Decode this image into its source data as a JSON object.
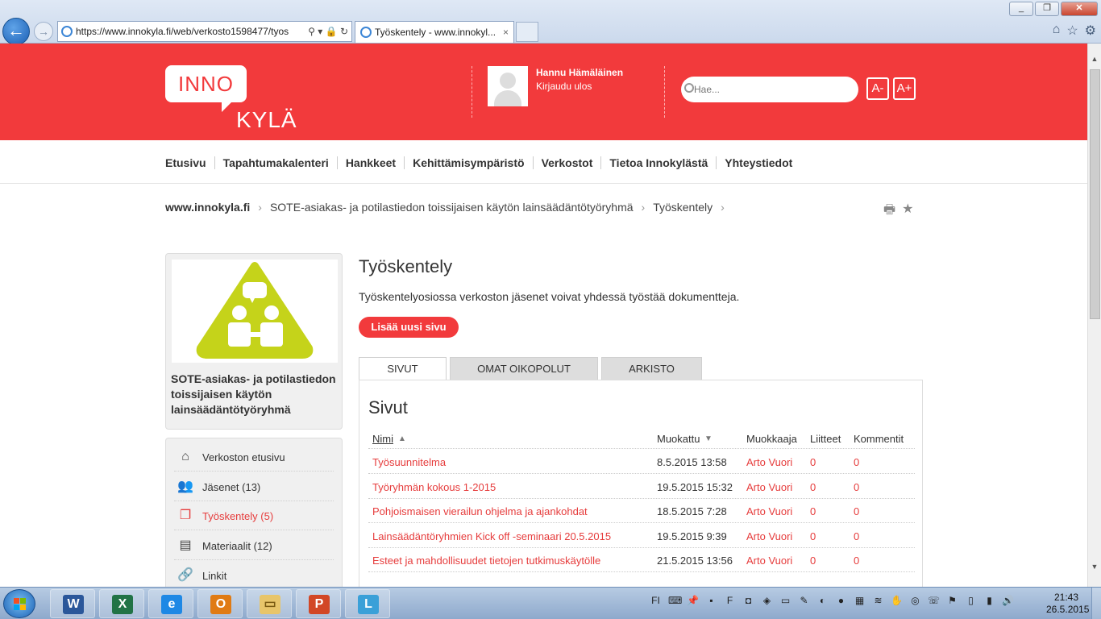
{
  "browser": {
    "url": "https://www.innokyla.fi/web/verkosto1598477/tyos",
    "tab_title": "Työskentely - www.innokyl...",
    "tab_close": "×"
  },
  "header": {
    "logo_top": "INNO",
    "logo_bottom": "KYLÄ",
    "user_name": "Hannu Hämäläinen",
    "logout": "Kirjaudu ulos",
    "search_placeholder": "Hae...",
    "font_smaller": "A-",
    "font_larger": "A+"
  },
  "nav": [
    "Etusivu",
    "Tapahtumakalenteri",
    "Hankkeet",
    "Kehittämisympäristö",
    "Verkostot",
    "Tietoa Innokylästä",
    "Yhteystiedot"
  ],
  "breadcrumb": {
    "items": [
      "www.innokyla.fi",
      "SOTE-asiakas- ja potilastiedon toissijaisen käytön lainsäädäntötyöryhmä",
      "Työskentely"
    ],
    "sep": "›"
  },
  "sidebar": {
    "group_title": "SOTE-asiakas- ja potilastiedon toissijaisen käytön lainsäädäntötyöryhmä",
    "items": [
      {
        "label": "Verkoston etusivu",
        "icon": "home-icon",
        "active": false
      },
      {
        "label": "Jäsenet (13)",
        "icon": "members-icon",
        "active": false
      },
      {
        "label": "Työskentely (5)",
        "icon": "documents-icon",
        "active": true
      },
      {
        "label": "Materiaalit (12)",
        "icon": "materials-icon",
        "active": false
      },
      {
        "label": "Linkit",
        "icon": "link-icon",
        "active": false
      }
    ]
  },
  "main": {
    "title": "Työskentely",
    "intro": "Työskentelyosiossa verkoston jäsenet voivat yhdessä työstää dokumentteja.",
    "add_button": "Lisää uusi sivu",
    "tabs": [
      "SIVUT",
      "OMAT OIKOPOLUT",
      "ARKISTO"
    ],
    "panel_title": "Sivut",
    "columns": {
      "name": "Nimi",
      "modified": "Muokattu",
      "editor": "Muokkaaja",
      "attachments": "Liitteet",
      "comments": "Kommentit"
    },
    "sort_asc": "▲",
    "sort_desc": "▼",
    "rows": [
      {
        "name": "Työsuunnitelma",
        "modified": "8.5.2015 13:58",
        "editor": "Arto Vuori",
        "attachments": "0",
        "comments": "0"
      },
      {
        "name": "Työryhmän kokous 1-2015",
        "modified": "19.5.2015 15:32",
        "editor": "Arto Vuori",
        "attachments": "0",
        "comments": "0"
      },
      {
        "name": "Pohjoismaisen vierailun ohjelma ja ajankohdat",
        "modified": "18.5.2015 7:28",
        "editor": "Arto Vuori",
        "attachments": "0",
        "comments": "0"
      },
      {
        "name": "Lainsäädäntöryhmien Kick off -seminaari 20.5.2015",
        "modified": "19.5.2015 9:39",
        "editor": "Arto Vuori",
        "attachments": "0",
        "comments": "0"
      },
      {
        "name": "Esteet ja mahdollisuudet tietojen tutkimuskäytölle",
        "modified": "21.5.2015 13:56",
        "editor": "Arto Vuori",
        "attachments": "0",
        "comments": "0"
      }
    ]
  },
  "taskbar": {
    "language": "FI",
    "time": "21:43",
    "date": "26.5.2015",
    "apps": [
      "word-icon",
      "excel-icon",
      "internet-explorer-icon",
      "outlook-icon",
      "file-explorer-icon",
      "powerpoint-icon",
      "lync-icon"
    ]
  },
  "colors": {
    "brand_red": "#f23a3c",
    "link_red": "#e63c3c",
    "logo_green": "#c5d31a"
  }
}
